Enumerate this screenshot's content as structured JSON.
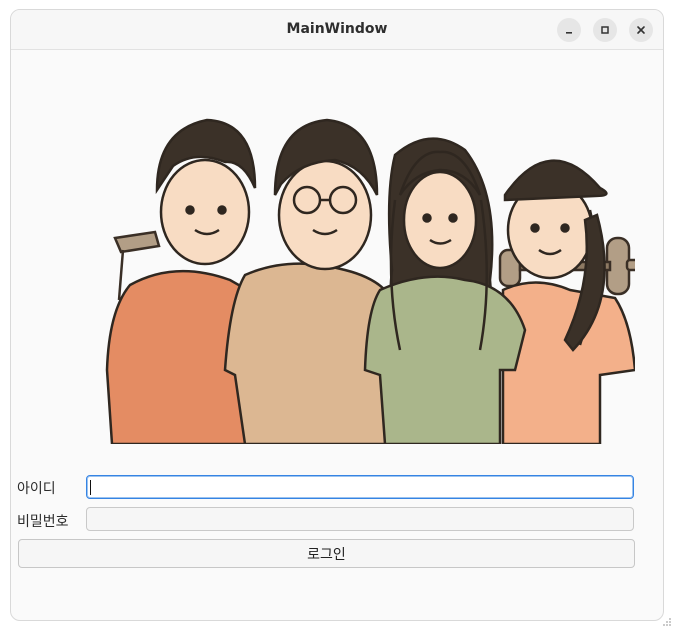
{
  "window": {
    "title": "MainWindow"
  },
  "controls": {
    "minimize_icon": "minimize-icon",
    "maximize_icon": "maximize-icon",
    "close_icon": "close-icon"
  },
  "illustration": {
    "subject": "four people",
    "icon": "people-illustration"
  },
  "form": {
    "id_label": "아이디",
    "id_value": "",
    "password_label": "비밀번호",
    "password_value": "",
    "login_label": "로그인"
  },
  "colors": {
    "focus_border": "#3584e4",
    "shirt_1": "#e48c63",
    "shirt_2": "#dcb792",
    "shirt_3": "#aab68b",
    "shirt_4": "#f3b08a",
    "hair": "#3b3128"
  }
}
